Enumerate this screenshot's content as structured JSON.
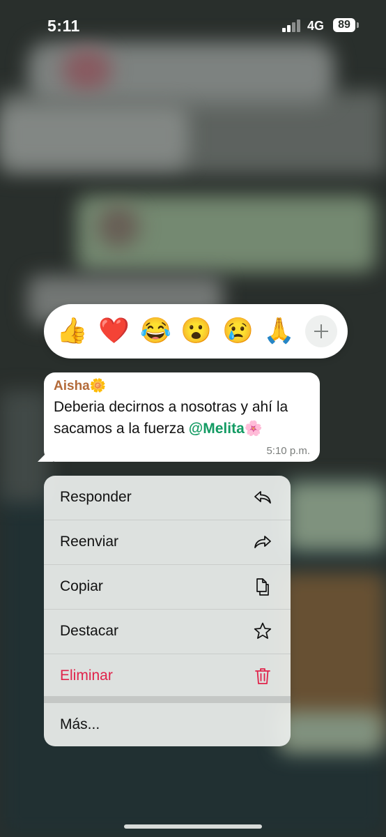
{
  "status_bar": {
    "time": "5:11",
    "network": "4G",
    "battery": "89"
  },
  "reactions": {
    "emojis": [
      "👍",
      "❤️",
      "😂",
      "😮",
      "😢",
      "🙏"
    ],
    "more_icon": "plus-icon"
  },
  "message": {
    "sender": "Aisha🌼",
    "text": "Deberia decirnos a nosotras y ahí la sacamos a la fuerza ",
    "mention": "@Melita🌸",
    "time": "5:10 p.m.",
    "colors": {
      "sender": "#b36a39",
      "mention": "#139b63"
    }
  },
  "menu": {
    "items": [
      {
        "label": "Responder",
        "icon": "reply-icon"
      },
      {
        "label": "Reenviar",
        "icon": "forward-icon"
      },
      {
        "label": "Copiar",
        "icon": "copy-icon"
      },
      {
        "label": "Destacar",
        "icon": "star-icon"
      },
      {
        "label": "Eliminar",
        "icon": "trash-icon",
        "color": "#e0224a"
      },
      {
        "label": "Más...",
        "icon": ""
      }
    ]
  }
}
